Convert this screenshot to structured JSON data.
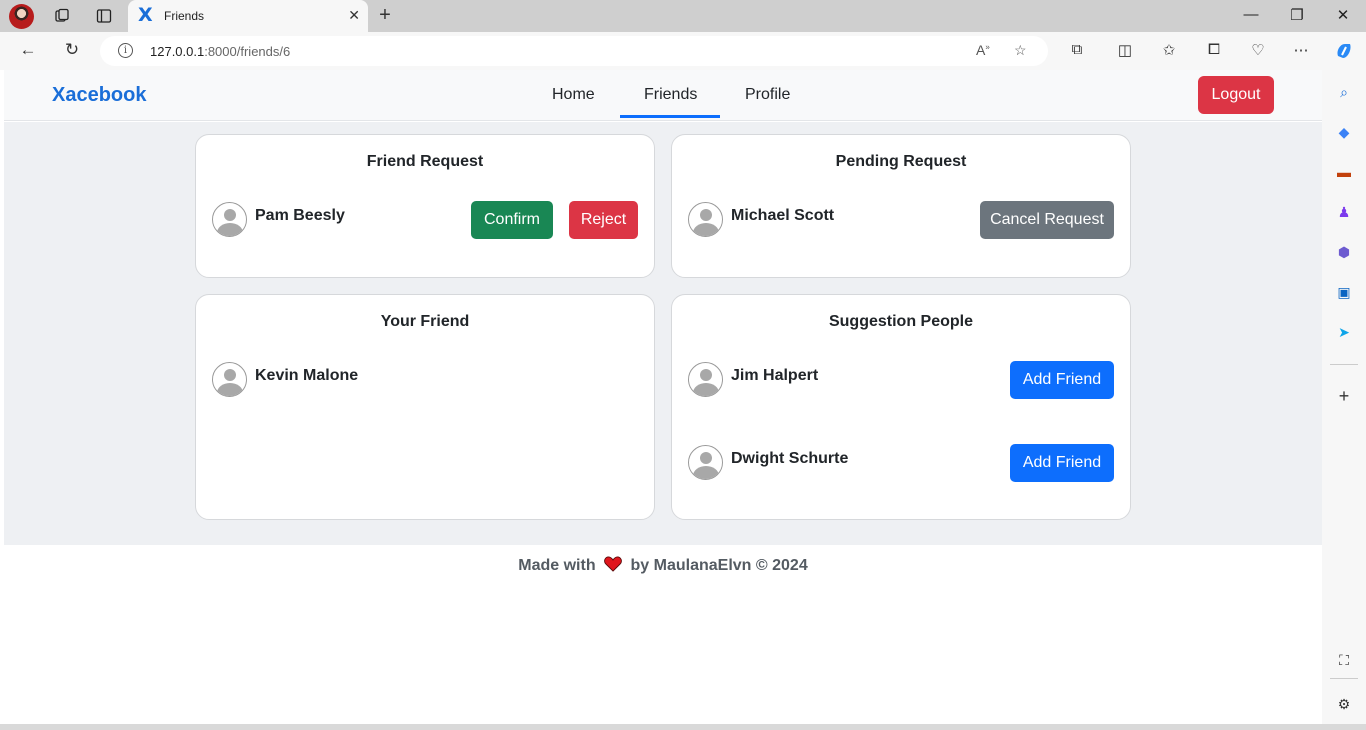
{
  "browser": {
    "tab_title": "Friends",
    "tab_favicon": "X",
    "url_host": "127.0.0.1",
    "url_rest": ":8000/friends/6"
  },
  "site": {
    "brand": "Xacebook",
    "nav": [
      "Home",
      "Friends",
      "Profile"
    ],
    "active_nav": "Friends",
    "logout_label": "Logout"
  },
  "friend_request": {
    "title": "Friend Request",
    "people": [
      {
        "name": "Pam Beesly"
      }
    ],
    "confirm_label": "Confirm",
    "reject_label": "Reject"
  },
  "pending_request": {
    "title": "Pending Request",
    "people": [
      {
        "name": "Michael Scott"
      }
    ],
    "cancel_label": "Cancel Request"
  },
  "your_friend": {
    "title": "Your Friend",
    "people": [
      {
        "name": "Kevin Malone"
      }
    ]
  },
  "suggestion": {
    "title": "Suggestion People",
    "people": [
      {
        "name": "Jim Halpert"
      },
      {
        "name": "Dwight Schurte"
      }
    ],
    "add_label": "Add Friend"
  },
  "footer": {
    "made_with": "Made with",
    "by_text": "by MaulanaElvn © 2024"
  },
  "colors": {
    "brand": "#1a6ed8",
    "primary": "#0d6efd",
    "success": "#198754",
    "danger": "#dc3545",
    "secondary": "#6c757d"
  }
}
